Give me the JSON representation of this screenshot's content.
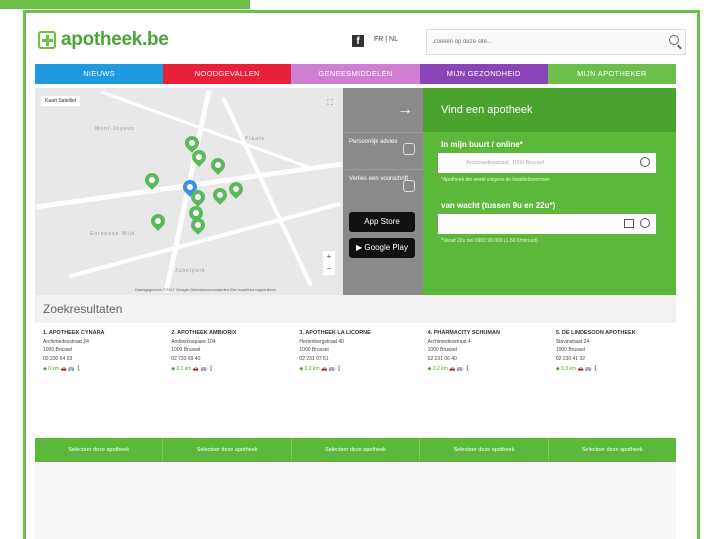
{
  "header": {
    "logo_text": "apotheek.be",
    "lang": "FR | NL",
    "search_placeholder": "Zoeken op deze site..."
  },
  "nav": [
    {
      "label": "Nieuws",
      "color": "#1e9be0"
    },
    {
      "label": "Noodgevallen",
      "color": "#e8203a"
    },
    {
      "label": "Geneesmiddelen",
      "color": "#cf7fd1"
    },
    {
      "label": "Mijn gezondheid",
      "color": "#8a44b8"
    },
    {
      "label": "Mijn apotheker",
      "color": "#6cc04a"
    }
  ],
  "map": {
    "controls": "Kaart  Satelliet",
    "street1": "Mont-Joyeux",
    "street2": "Plaats",
    "street3": "Europese Wijk",
    "street4": "Jubelpark",
    "footer": "Kaartgegevens ©2017 Google   Gebruiksvoorwaarden   Een kaartfout rapporteren"
  },
  "sidebar": {
    "item1": "Persoonlijk advies",
    "item2": "Verlies een voorschrift",
    "app_store": "App Store",
    "google_play": "Google Play"
  },
  "finder": {
    "title": "Vind een apotheek",
    "label1": "In mijn buurt / online*",
    "input1_placeholder": "Archimedesstraat, 1000 Brussel",
    "hint1": "*Apotheek die werkt volgens de kwaliteitsnormen",
    "label2": "van wacht (tussen 9u en 22u*)",
    "hint2": "*Vanaf 22u bel 0903 99 000 (1,50 €/minuut)"
  },
  "results": {
    "title": "Zoekresultaten",
    "items": [
      {
        "name": "1. Apotheek Cynara",
        "street": "Archimedesstraat 24",
        "city": "1000 Brussel",
        "phone": "02 230 64 03",
        "distance": "0 km"
      },
      {
        "name": "2. Apotheek Ambiorix",
        "street": "Ambiorixsquare 104",
        "city": "1000 Brussel",
        "phone": "02 733 69 40",
        "distance": "0,1 km"
      },
      {
        "name": "3. Apotheek La Licorne",
        "street": "Hertenbergstraat 40",
        "city": "1000 Brussel",
        "phone": "02 231 07 51",
        "distance": "0,2 km"
      },
      {
        "name": "4. Pharmacity Schuman",
        "street": "Archimedesstraat 4",
        "city": "1000 Brussel",
        "phone": "02 231 06 40",
        "distance": "0,2 km"
      },
      {
        "name": "5. De Lindesoon Apotheek",
        "street": "Stevinstraat 24",
        "city": "1000 Brussel",
        "phone": "02 230 41 32",
        "distance": "0,3 km"
      }
    ],
    "select_label": "Selecteer deze apotheek"
  }
}
